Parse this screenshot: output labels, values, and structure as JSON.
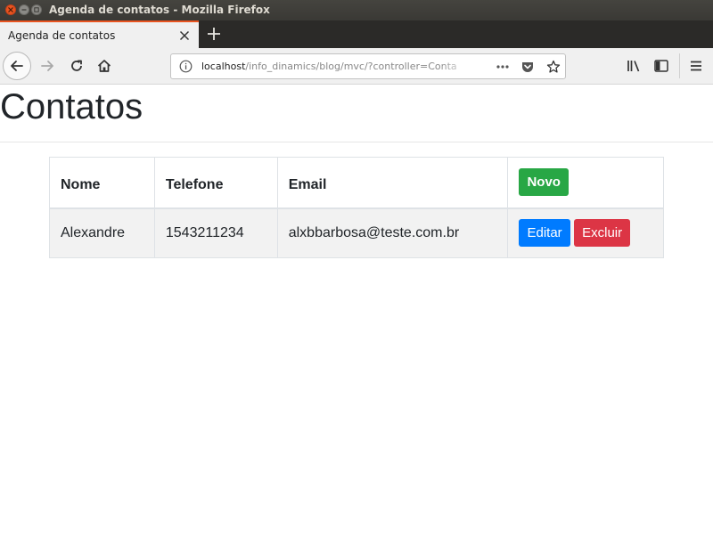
{
  "window": {
    "title": "Agenda de contatos - Mozilla Firefox"
  },
  "tab": {
    "label": "Agenda de contatos"
  },
  "address_bar": {
    "host": "localhost",
    "path": "/info_dinamics/blog/mvc/?controller=ContatosController"
  },
  "page": {
    "title": "Contatos",
    "table": {
      "headers": [
        "Nome",
        "Telefone",
        "Email"
      ],
      "new_button": "Novo",
      "rows": [
        {
          "nome": "Alexandre",
          "telefone": "1543211234",
          "email": "alxbbarbosa@teste.com.br",
          "edit_label": "Editar",
          "delete_label": "Excluir"
        }
      ]
    }
  },
  "colors": {
    "success": "#28a745",
    "primary": "#007bff",
    "danger": "#dc3545",
    "ubuntu_orange": "#e95420"
  },
  "icons": [
    "close-window-icon",
    "minimize-icon",
    "maximize-icon",
    "tab-close-icon",
    "new-tab-icon",
    "back-arrow-icon",
    "forward-arrow-icon",
    "reload-icon",
    "home-icon",
    "info-icon",
    "more-actions-icon",
    "pocket-icon",
    "bookmark-star-icon",
    "library-icon",
    "sidebar-icon",
    "hamburger-menu-icon"
  ]
}
